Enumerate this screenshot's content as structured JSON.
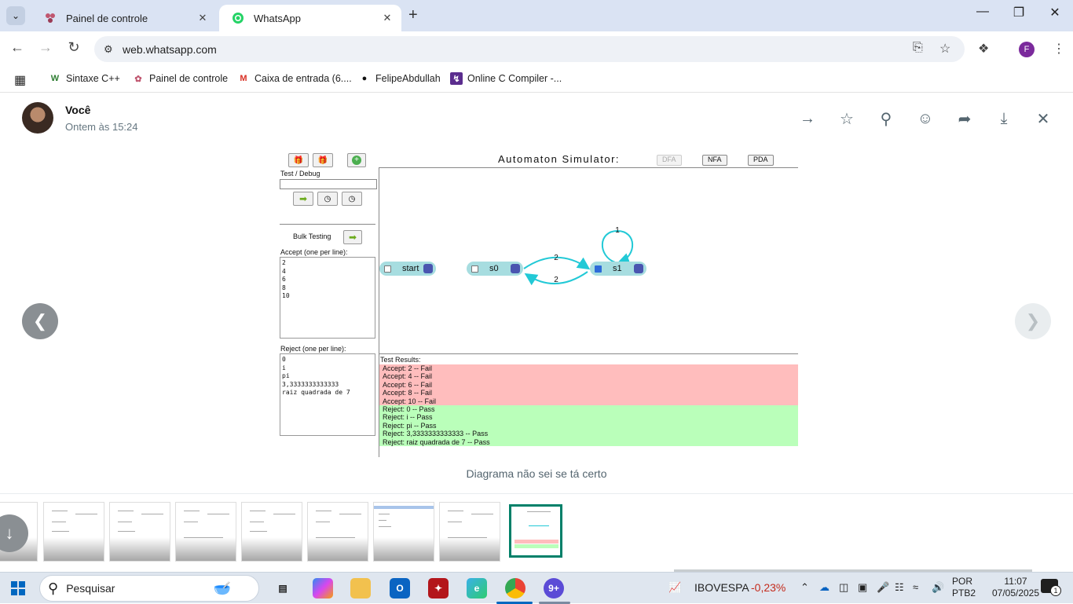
{
  "browser": {
    "tabs": [
      {
        "label": "Painel de controle",
        "active": false,
        "icon": "painel-favicon"
      },
      {
        "label": "WhatsApp",
        "active": true,
        "icon": "whatsapp-favicon"
      }
    ],
    "url": "web.whatsapp.com",
    "profile_initial": "F",
    "bookmarks": [
      {
        "label": "Sintaxe C++",
        "icon": "w-icon"
      },
      {
        "label": "Painel de controle",
        "icon": "painel-icon"
      },
      {
        "label": "Caixa de entrada (6....",
        "icon": "gmail-icon"
      },
      {
        "label": "FelipeAbdullah",
        "icon": "github-icon"
      },
      {
        "label": "Online C Compiler -...",
        "icon": "compiler-icon"
      }
    ]
  },
  "viewer": {
    "sender": "Você",
    "time": "Ontem às 15:24",
    "caption": "Diagrama não sei se tá certo"
  },
  "simulator": {
    "title": "Automaton   Simulator:",
    "modes": [
      "DFA",
      "NFA",
      "PDA"
    ],
    "test_debug_label": "Test / Debug",
    "bulk_testing_label": "Bulk Testing",
    "accept_label": "Accept (one per line):",
    "accept_values": [
      "2",
      "4",
      "6",
      "8",
      "10"
    ],
    "reject_label": "Reject (one per line):",
    "reject_values": [
      "0",
      "i",
      "pi",
      "3,3333333333333",
      "raiz quadrada de 7"
    ],
    "results_label": "Test Results:",
    "fail_results": [
      "Accept: 2 -- Fail",
      "Accept: 4 -- Fail",
      "Accept: 6 -- Fail",
      "Accept: 8 -- Fail",
      "Accept: 10 -- Fail"
    ],
    "pass_results": [
      "Reject: 0 -- Pass",
      "Reject: i -- Pass",
      "Reject: pi -- Pass",
      "Reject: 3,3333333333333 -- Pass",
      "Reject: raiz quadrada de 7 -- Pass"
    ],
    "states": [
      {
        "name": "start",
        "accepting": false
      },
      {
        "name": "s0",
        "accepting": false
      },
      {
        "name": "s1",
        "accepting": true
      }
    ],
    "transitions": [
      {
        "from": "s0",
        "to": "s1",
        "label": "2"
      },
      {
        "from": "s1",
        "to": "s0",
        "label": "2"
      },
      {
        "from": "s1",
        "to": "s1",
        "label": "1"
      }
    ],
    "colors": {
      "fail": "#ffbdbd",
      "pass": "#baffba",
      "state": "#a7dde0",
      "edge": "#22c9d6"
    }
  },
  "taskbar": {
    "search_placeholder": "Pesquisar",
    "ticker_name": "IBOVESPA",
    "ticker_value": "-0,23%",
    "lang_1": "POR",
    "lang_2": "PTB2",
    "time": "11:07",
    "date": "07/05/2025",
    "notification_count": "1"
  }
}
